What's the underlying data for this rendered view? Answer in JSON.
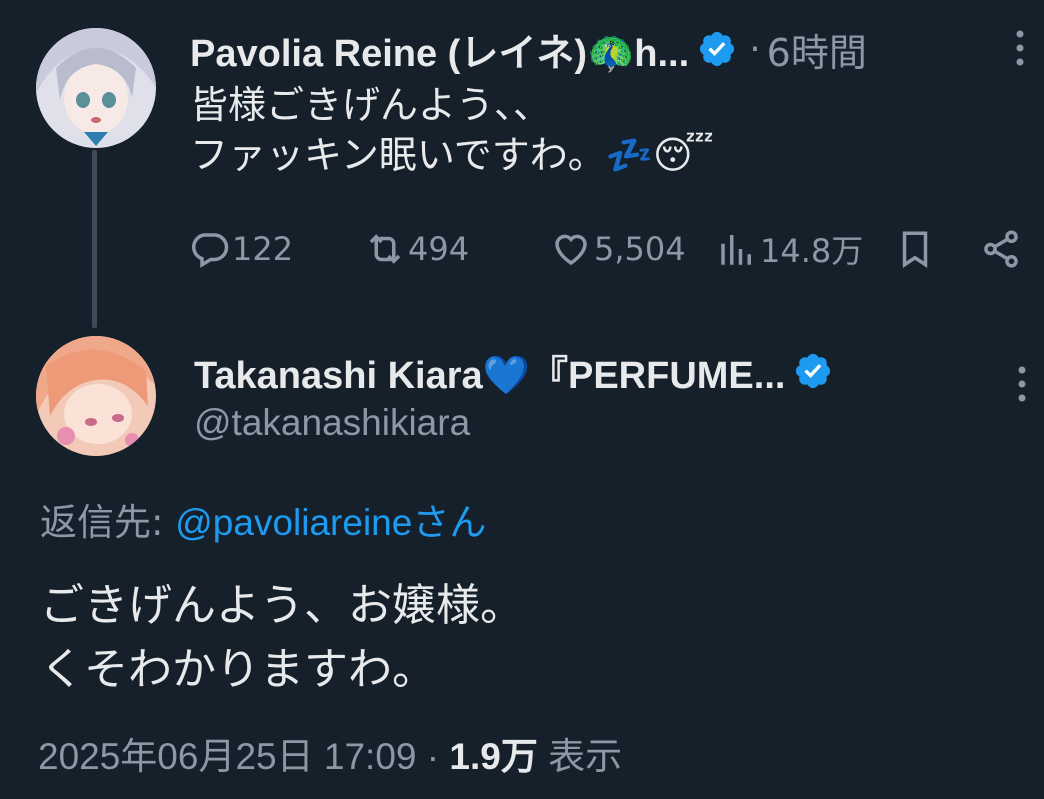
{
  "tweet1": {
    "display_name": "Pavolia Reine (レイネ)🦚h...",
    "verified": true,
    "separator": "·",
    "time": "6時間",
    "text": "皆様ごきげんよう、、\nファッキン眠いですわ。💤😴",
    "stats": {
      "replies": "122",
      "retweets": "494",
      "likes": "5,504",
      "views": "14.8万"
    }
  },
  "tweet2": {
    "display_name": "Takanashi Kiara💙『PERFUME...",
    "verified": true,
    "handle": "@takanashikiara",
    "reply_prefix": "返信先:",
    "reply_mention": "@pavoliareineさん",
    "text": "ごきげんよう、お嬢様。\nくそわかりますわ。",
    "timestamp": "2025年06月25日 17:09",
    "separator": "·",
    "views_count": "1.9万",
    "views_label": "表示"
  },
  "colors": {
    "background": "#15202b",
    "primary_text": "#e7e9ea",
    "secondary_text": "#8b98a5",
    "accent": "#1d9bf0"
  }
}
